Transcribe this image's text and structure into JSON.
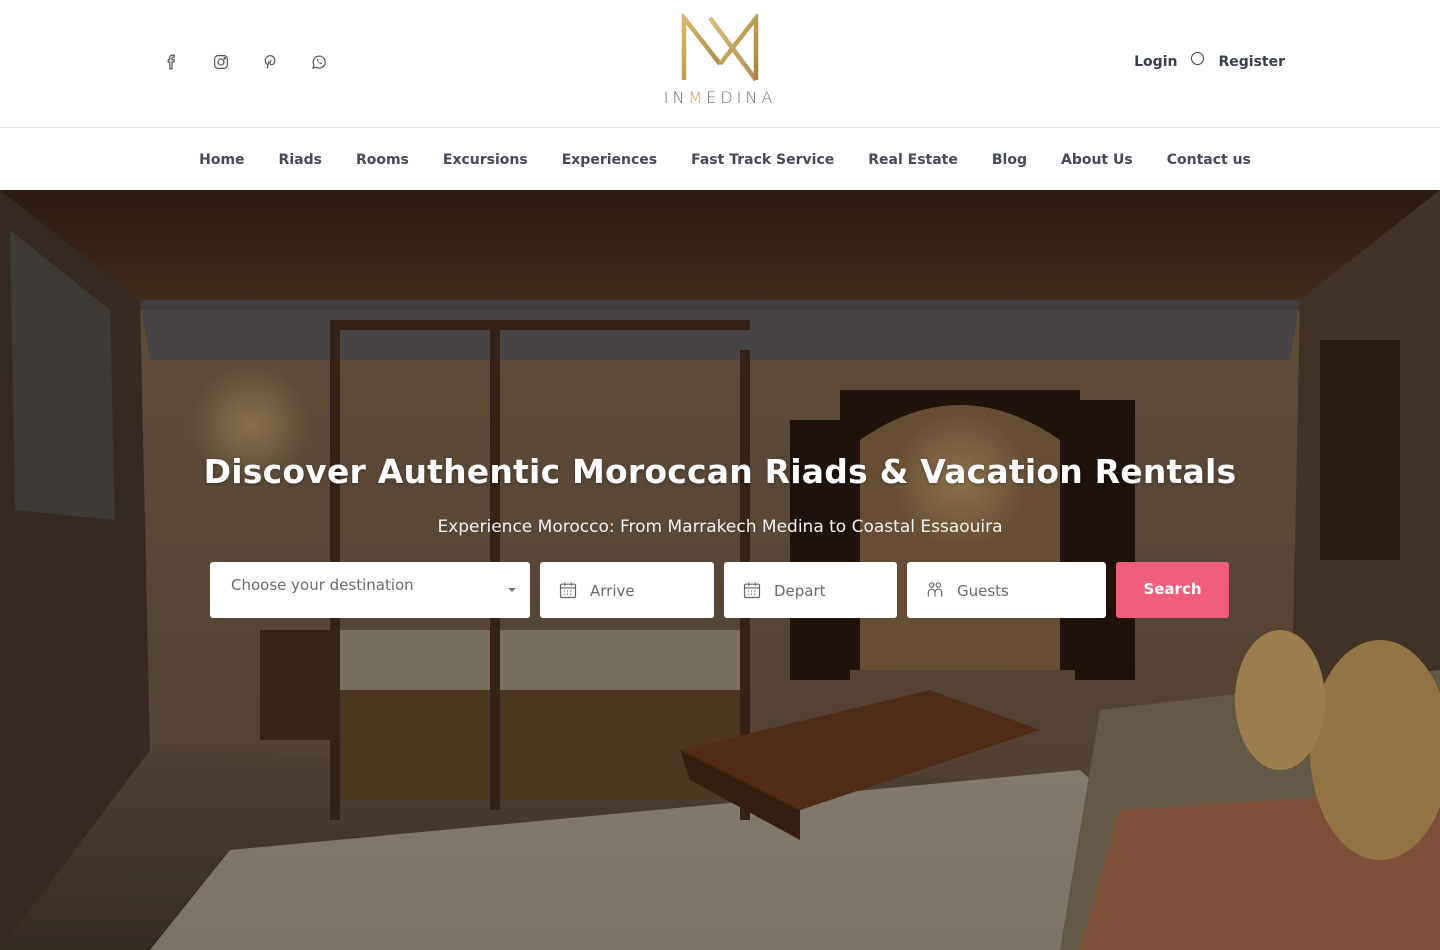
{
  "header": {
    "socials": [
      {
        "icon": "facebook-icon"
      },
      {
        "icon": "instagram-icon"
      },
      {
        "icon": "pinterest-icon"
      },
      {
        "icon": "whatsapp-icon"
      }
    ],
    "logo": {
      "text_pre": "IN",
      "text_gold": "M",
      "text_post": "EDINA",
      "gold_color": "#c6a25c"
    },
    "auth": {
      "login": "Login",
      "register": "Register"
    }
  },
  "nav": {
    "items": [
      {
        "label": "Home"
      },
      {
        "label": "Riads"
      },
      {
        "label": "Rooms"
      },
      {
        "label": "Excursions"
      },
      {
        "label": "Experiences"
      },
      {
        "label": "Fast Track Service"
      },
      {
        "label": "Real Estate"
      },
      {
        "label": "Blog"
      },
      {
        "label": "About Us"
      },
      {
        "label": "Contact us"
      }
    ]
  },
  "hero": {
    "title": "Discover Authentic Moroccan Riads & Vacation Rentals",
    "subtitle": "Experience Morocco: From Marrakech Medina to Coastal Essaouira",
    "search": {
      "destination_placeholder": "Choose your destination",
      "arrive_placeholder": "Arrive",
      "depart_placeholder": "Depart",
      "guests_placeholder": "Guests",
      "button_label": "Search",
      "button_color": "#ef5d7a"
    }
  }
}
